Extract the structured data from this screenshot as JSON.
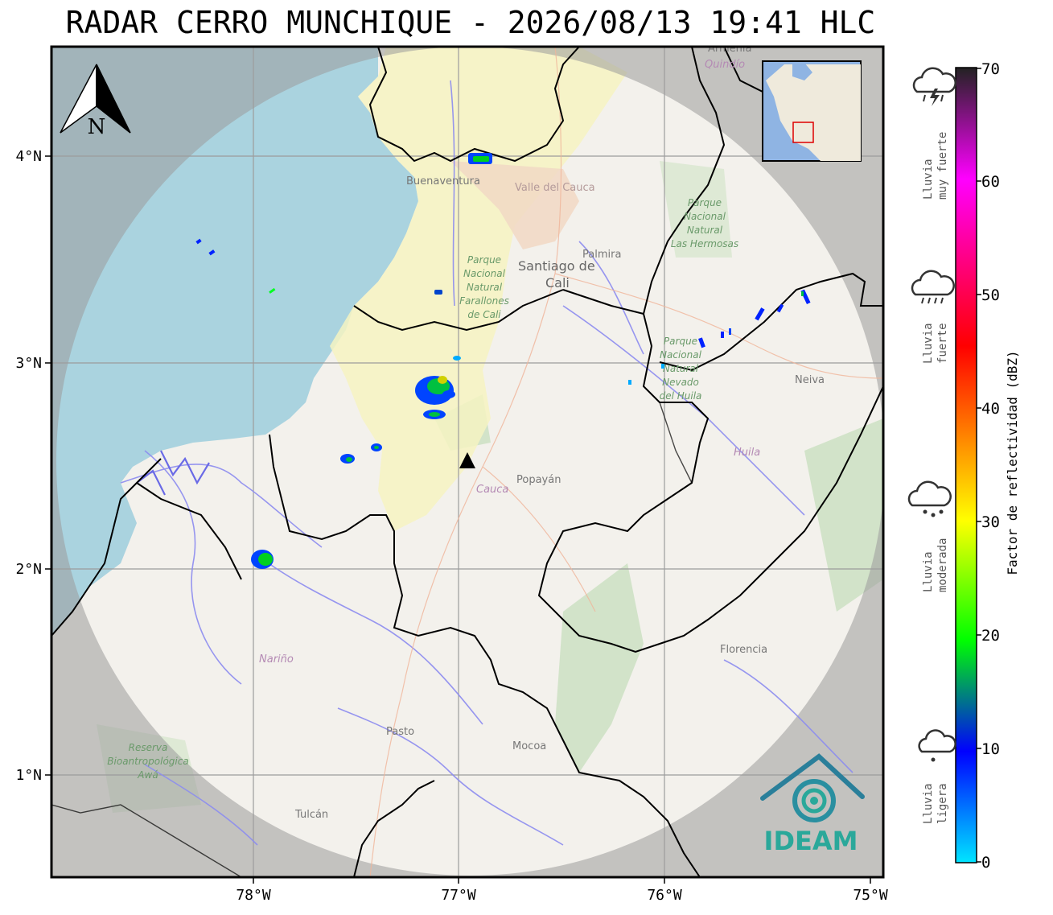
{
  "header": {
    "title": "RADAR CERRO MUNCHIQUE - 2026/08/13 19:41 HLC"
  },
  "map": {
    "north_arrow_label": "N",
    "x_ticks": [
      "78°W",
      "77°W",
      "76°W",
      "75°W"
    ],
    "y_ticks": [
      "4°N",
      "3°N",
      "2°N",
      "1°N"
    ],
    "places": {
      "buenaventura": "Buenaventura",
      "valle": "Valle del Cauca",
      "palmira": "Palmira",
      "cali_1": "Santiago de",
      "cali_2": "Cali",
      "neiva": "Neiva",
      "popayan": "Popayán",
      "cauca": "Cauca",
      "huila": "Huila",
      "narino": "Nariño",
      "florencia": "Florencia",
      "pasto": "Pasto",
      "mocoa": "Mocoa",
      "tulcan": "Tulcán",
      "armenia": "Armenia",
      "quindio": "Quindío"
    },
    "parks": {
      "hermosas": [
        "Parque",
        "Nacional",
        "Natural",
        "Las Hermosas"
      ],
      "farallones": [
        "Parque",
        "Nacional",
        "Natural",
        "Farallones",
        "de Cali"
      ],
      "huila_park": [
        "Parque",
        "Nacional",
        "Natural",
        "Nevado",
        "del Huila"
      ],
      "awa": [
        "Reserva",
        "Bioantropológica",
        "Awá"
      ]
    },
    "radar_site": {
      "lon": -76.95,
      "lat": 2.5
    },
    "extent": {
      "lon": [
        -78.97,
        -74.97
      ],
      "lat": [
        0.5,
        4.53
      ]
    },
    "colors": {
      "land": "#f7f5f2",
      "ocean": "#aad3df",
      "outside_range": "#c2c2c2",
      "accent": "#2aa89a"
    }
  },
  "colorbar": {
    "label": "Factor de reflectividad (dBZ)",
    "range": [
      0,
      70
    ],
    "ticks": [
      "0",
      "10",
      "20",
      "30",
      "40",
      "50",
      "60",
      "70"
    ],
    "stops": [
      "#00e5ff",
      "#0000ff",
      "#00ff00",
      "#ffff00",
      "#ff0000",
      "#ff00ff",
      "#222222"
    ],
    "categories": [
      {
        "lines": [
          "Lluvia",
          "muy fuerte"
        ],
        "icon": "thunderstorm-icon"
      },
      {
        "lines": [
          "Lluvia",
          "fuerte"
        ],
        "icon": "heavy-rain-icon"
      },
      {
        "lines": [
          "Lluvia",
          "moderada"
        ],
        "icon": "moderate-rain-icon"
      },
      {
        "lines": [
          "Lluvia",
          "ligera"
        ],
        "icon": "light-rain-icon"
      }
    ]
  },
  "logo": {
    "text": "IDEAM"
  }
}
